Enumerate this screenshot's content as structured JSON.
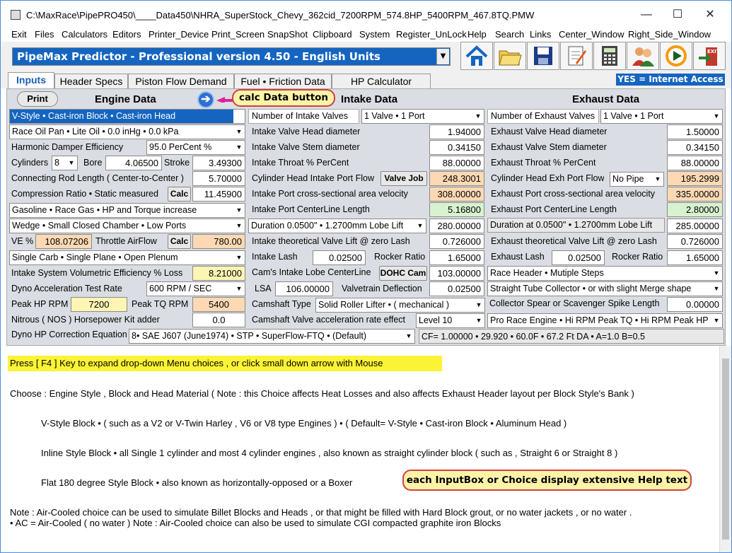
{
  "titlebar": {
    "title": "C:\\MaxRace\\PipePRO450\\____Data450\\NHRA_SuperStock_Chevy_362cid_7200RPM_574.8HP_5400RPM_467.8TQ.PMW",
    "min": "—",
    "max": "☐",
    "close": "✕"
  },
  "menu": [
    "Exit",
    "Files",
    "Calculators",
    "Editors",
    "Printer_Device",
    "Print_Screen",
    "SnapShot",
    "Clipboard",
    "System",
    "Register_UnLock",
    "Help",
    "Search",
    "Links",
    "Center_Window",
    "Right_Side_Window"
  ],
  "program_select": "PipeMax Predictor - Professional version 4.50 - English Units",
  "toolbar_icons": [
    "home-icon",
    "open-folder-icon",
    "save-disk-icon",
    "notepad-icon",
    "calculator-icon",
    "users-icon",
    "play-icon",
    "exit-icon"
  ],
  "tabs": [
    "Inputs",
    "Header Specs",
    "Piston Flow Demand",
    "Fuel • Friction Data",
    "HP Calculator"
  ],
  "yes_badge": "YES = Internet Access",
  "engine": {
    "print": "Print",
    "header": "Engine Data",
    "style": "V-Style  •  Cast-iron Block  •  Cast-iron Head",
    "oil": "Race Oil Pan  •  Lite Oil  •  0.0 inHg • 0.0 kPa",
    "damper_label": "Harmonic Damper Efficiency",
    "damper": "95.0 PerCent %",
    "cyl_label": "Cylinders",
    "cyl": "8",
    "bore_label": "Bore",
    "bore": "4.06500",
    "stroke_label": "Stroke",
    "stroke": "3.49300",
    "rod_label": "Connecting Rod Length  ( Center-to-Center )",
    "rod": "5.70000",
    "cr_label": "Compression Ratio • Static measured",
    "cr_btn": "Calc",
    "cr": "11.45900",
    "fuel": "Gasoline  •  Race Gas  •  HP  and  Torque  increase",
    "chamber": "Wedge  •  Small Closed Chamber  •  Low Ports",
    "ve_label": "VE %",
    "ve": "108.07206",
    "ta_label": "Throttle AirFlow",
    "ta_btn": "Calc",
    "ta": "780.00",
    "carb": "Single Carb  •  Single Plane  •  Open Plenum",
    "ivel_label": "Intake System Volumetric Efficiency % Loss",
    "ivel": "8.21000",
    "accel_label": "Dyno Acceleration Test Rate",
    "accel": "600  RPM / SEC",
    "peakhp_label": "Peak HP RPM",
    "peakhp": "7200",
    "peaktq_label": "Peak TQ RPM",
    "peaktq": "5400",
    "nos_label": "Nitrous  ( NOS )  Horsepower  Kit  adder",
    "nos": "0.0",
    "corr_label": "Dyno HP Correction Equation",
    "corr": "8•  SAE J607 (June1974)  •  STP  •  SuperFlow-FTQ   •  (Default)",
    "cf": "CF= 1.00000  •  29.920  •  60.0F  •  67.2 Ft DA   •  A=1.0  B=0.5"
  },
  "calc_callout": "calc Data button",
  "intake": {
    "header": "Intake Data",
    "nvalves_label": "Number of Intake Valves",
    "nvalves": "1 Valve  •  1 Port",
    "head_label": "Intake Valve Head diameter",
    "head": "1.94000",
    "stem_label": "Intake Valve Stem diameter",
    "stem": "0.34150",
    "throat_label": "Intake Throat % PerCent",
    "throat": "88.00000",
    "flow_label": "Cylinder Head Intake Port Flow",
    "flow_btn": "Valve Job",
    "flow": "248.3001",
    "vel_label": "Intake Port cross-sectional area velocity",
    "vel": "308.00000",
    "cl_label": "Intake Port CenterLine Length",
    "cl": "5.16800",
    "dur_label": "Duration 0.0500\" • 1.2700mm Lobe Lift",
    "dur": "280.00000",
    "lift_label": "Intake theoretical Valve Lift @ zero Lash",
    "lift": "0.726000",
    "lash_label": "Intake  Lash",
    "lash": "0.02500",
    "rr_label": "Rocker Ratio",
    "rr": "1.65000",
    "lobe_label": "Cam's Intake Lobe CenterLine",
    "lobe_btn": "DOHC Cam",
    "lobe": "103.00000",
    "lsa_label": "LSA",
    "lsa": "106.00000",
    "defl_label": "Valvetrain Deflection",
    "defl": "0.02500",
    "camtype_label": "Camshaft Type",
    "camtype": "Solid  Roller  Lifter  •  ( mechanical )",
    "camaccel_label": "Camshaft Valve acceleration rate effect",
    "camaccel": "Level  10"
  },
  "exhaust": {
    "header": "Exhaust Data",
    "nvalves_label": "Number of Exhaust Valves",
    "nvalves": "1 Valve  •  1 Port",
    "head_label": "Exhaust Valve Head diameter",
    "head": "1.50000",
    "stem_label": "Exhaust Valve Stem diameter",
    "stem": "0.34150",
    "throat_label": "Exhaust Throat % PerCent",
    "throat": "88.00000",
    "flow_label": "Cylinder Head Exh Port Flow",
    "pipe": "No Pipe",
    "flow": "195.2999",
    "vel_label": "Exhaust Port cross-sectional area velocity",
    "vel": "335.00000",
    "cl_label": "Exhaust Port CenterLine Length",
    "cl": "2.80000",
    "dur_label": "Duration at 0.0500\" • 1.2700mm Lobe Lift",
    "dur": "285.00000",
    "lift_label": "Exhaust theoretical Valve Lift @ zero Lash",
    "lift": "0.726000",
    "lash_label": "Exhaust  Lash",
    "lash": "0.02500",
    "rr_label": "Rocker Ratio",
    "rr": "1.65000",
    "header_sel": "Race Header  •  Mutiple Steps",
    "collector": "Straight Tube Collector  •  or with slight Merge shape",
    "spear_label": "Collector Spear or Scavenger Spike Length",
    "spear": "0.00000",
    "engtype": "Pro Race Engine • Hi RPM Peak TQ • Hi RPM Peak HP"
  },
  "help": {
    "f4": "Press  [ F4 ]  Key to expand drop-down Menu choices ,  or click small down arrow with Mouse",
    "l1": "Choose :   Engine Style , Block and Head Material     ( Note :  this Choice affects Heat Losses and also affects Exhaust Header layout per Block Style's Bank )",
    "l2": "V-Style Block   •    ( such as a V2 or V-Twin Harley ,  V6  or  V8 type Engines )       •       ( Default=  V-Style • Cast-iron Block • Aluminum Head )",
    "l3": "Inline Style Block   •    all Single 1 cylinder and most 4 cylinder engines ,  also known as straight cylinder block  ( such as , Straight 6 or Straight 8 )",
    "l4": "Flat 180 degree Style Block   •    also known as horizontally-opposed or a Boxer",
    "callout": "each InputBox or Choice display extensive Help text",
    "l5": "Note :  Air-Cooled choice can be used to simulate Billet Blocks and Heads ,  or  that might be filled with Hard Block grout, or no water jackets , or no water .",
    "l6": "• AC =  Air-Cooled ( no water )     Note :  Air-Cooled choice can also be used to simulate CGI compacted graphite iron Blocks"
  },
  "colors": {
    "blue": "#1565c0",
    "yellow": "#fbf335",
    "peach": "#fcd9b4",
    "green": "#d8f2d0",
    "ltyellow": "#fcf5b4"
  }
}
